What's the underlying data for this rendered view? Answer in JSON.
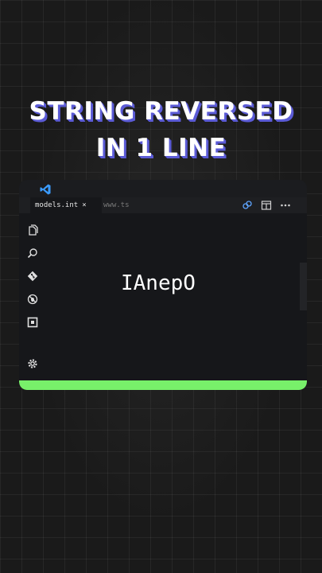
{
  "headline": {
    "line1": "STRING REVERSED",
    "line2": "IN 1 LINE"
  },
  "editor": {
    "tabs": [
      {
        "label": "models.int",
        "close": "×",
        "active": true
      },
      {
        "label": "www.ts",
        "active": false
      }
    ],
    "tab_action_icons": [
      "compare-changes-icon",
      "split-editor-icon",
      "more-actions-icon"
    ],
    "activity_icons": [
      "explorer-icon",
      "search-icon",
      "source-control-icon",
      "no-debug-icon",
      "extensions-icon",
      "settings-gear-icon"
    ],
    "code_text": "IAnepO",
    "status_bar_color": "#78f06a"
  },
  "colors": {
    "background": "#1a1a1a",
    "headline_shadow": "#5b5bd6",
    "vscode_blue": "#3b9cff"
  }
}
